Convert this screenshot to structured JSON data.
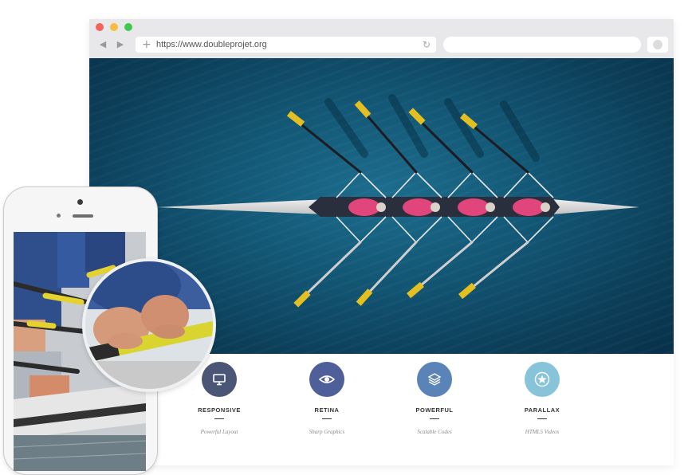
{
  "browser": {
    "url": "https://www.doubleprojet.org",
    "icons": {
      "back": "back-arrow-icon",
      "forward": "forward-arrow-icon",
      "new_tab": "plus-icon",
      "reload": "reload-icon"
    }
  },
  "hero": {
    "image": "aerial view of a four-person rowing boat on blue water",
    "colors": {
      "water": "#125674",
      "shirts": "#e0457b",
      "oar_blades": "#e3c020"
    }
  },
  "features": [
    {
      "icon": "monitor-icon",
      "title": "RESPONSIVE",
      "subtitle": "Powerful Layout",
      "color": "#4b5677"
    },
    {
      "icon": "eye-icon",
      "title": "RETINA",
      "subtitle": "Sharp Graphics",
      "color": "#4f5f9a"
    },
    {
      "icon": "layers-icon",
      "title": "POWERFUL",
      "subtitle": "Scalable Codes",
      "color": "#5a83b8"
    },
    {
      "icon": "star-icon",
      "title": "PARALLAX",
      "subtitle": "HTML5 Videos",
      "color": "#88c4d9"
    }
  ],
  "phone": {
    "image": "close-up of rowers gripping yellow-handled oars",
    "zoom_image": "magnified hands gripping a yellow oar handle"
  }
}
